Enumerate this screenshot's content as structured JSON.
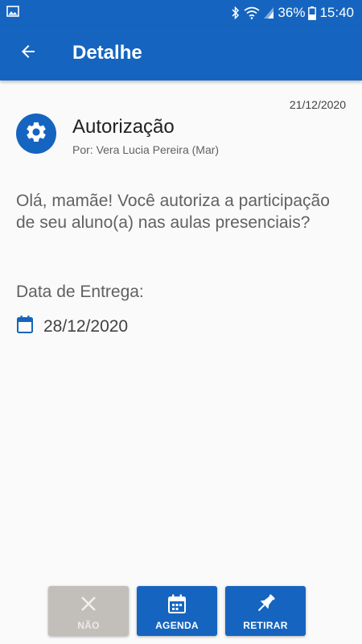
{
  "status_bar": {
    "battery": "36%",
    "time": "15:40",
    "icons": [
      "gallery-icon",
      "bluetooth-icon",
      "wifi-icon",
      "signal-icon",
      "battery-icon"
    ]
  },
  "app_bar": {
    "title": "Detalhe",
    "back_icon": "arrow-back-icon"
  },
  "message": {
    "date": "21/12/2020",
    "category_icon": "settings-icon",
    "title": "Autorização",
    "author": "Por: Vera Lucia Pereira (Mar)",
    "body": "Olá, mamãe! Você autoriza a participação de seu aluno(a) nas aulas presenciais?",
    "due_label": "Data de Entrega:",
    "due_date": "28/12/2020",
    "due_icon": "calendar-icon"
  },
  "actions": [
    {
      "label": "NÃO",
      "icon": "close-icon",
      "enabled": false
    },
    {
      "label": "AGENDA",
      "icon": "calendar-icon",
      "enabled": true
    },
    {
      "label": "RETIRAR",
      "icon": "pin-icon",
      "enabled": true
    }
  ],
  "colors": {
    "primary": "#1565c0",
    "disabled": "#c2bfbb",
    "background": "#fafafa"
  }
}
